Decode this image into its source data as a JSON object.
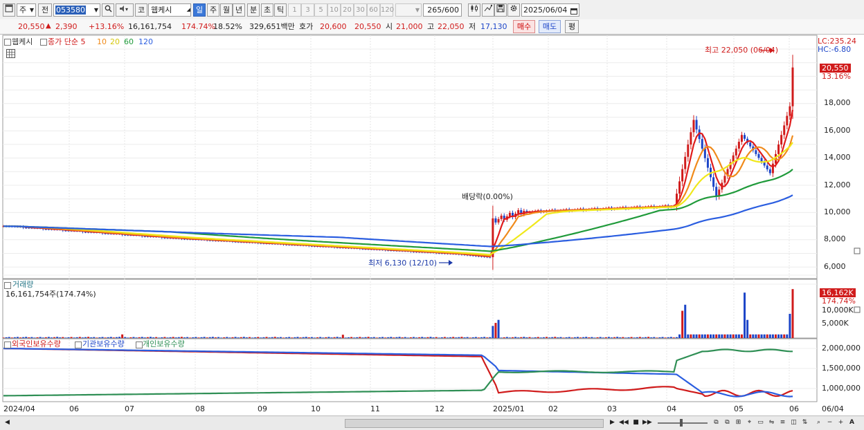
{
  "toolbar": {
    "market_select": "주",
    "prev_label": "전",
    "code_value": "053580",
    "market_kind": "코",
    "stock_name": "웹케시",
    "period_buttons": [
      "일",
      "주",
      "월",
      "년",
      "분",
      "초",
      "틱"
    ],
    "interval_buttons": [
      "1",
      "3",
      "5",
      "10",
      "20",
      "30",
      "60",
      "120"
    ],
    "count_value": "265",
    "count_total": "/600",
    "date_value": "2025/06/04"
  },
  "quote": {
    "price": "20,550",
    "change": "2,390",
    "change_pct": "+13.16%",
    "volume": "16,161,754",
    "vol_ratio": "174.74%",
    "turnover": "18.52%",
    "amount": "329,651백만",
    "bid_label": "호가",
    "bid": "20,600",
    "ask": "20,550",
    "open_label": "시",
    "open": "21,000",
    "high_label": "고",
    "high": "22,050",
    "low_label": "저",
    "low": "17,130",
    "buy_button": "매수",
    "sell_button": "매도",
    "eval_button": "평"
  },
  "price_panel": {
    "legend_name": "웹케시",
    "ma_label": "종가 단순 5",
    "ma_periods": [
      "10",
      "20",
      "60",
      "120"
    ],
    "lc_label": "LC:235.24",
    "hc_label": "HC:-6.80",
    "last_price_tag": "20,550",
    "last_pct_tag": "13.16%",
    "y_ticks": [
      "18,000",
      "16,000",
      "14,000",
      "12,000",
      "10,000",
      "8,000",
      "6,000"
    ],
    "high_annotation": "최고 22,050 (06/04)",
    "low_annotation": "최저 6,130 (12/10)",
    "dividend_annotation": "배당락(0.00%)"
  },
  "volume_panel": {
    "title": "거래량",
    "value_label": "16,161,754주(174.74%)",
    "tag_value": "16,162K",
    "tag_pct": "174.74%",
    "y_ticks": [
      "10,000K",
      "5,000K"
    ]
  },
  "holding_panel": {
    "legend": [
      "외국인보유수량",
      "기관보유수량",
      "개인보유수량"
    ],
    "y_ticks": [
      "2,000,000",
      "1,500,000",
      "1,000,000"
    ]
  },
  "x_axis": {
    "labels": [
      "2024/04",
      "06",
      "07",
      "08",
      "09",
      "10",
      "11",
      "12",
      "2025/01",
      "02",
      "03",
      "04",
      "05",
      "06"
    ],
    "right_label": "06/04"
  },
  "colors": {
    "rise": "#d01b1b",
    "fall": "#1c45c8",
    "ma5": "#e01b1b",
    "ma10": "#f08a1a",
    "ma20": "#f0e81a",
    "ma60": "#1f9a3a",
    "ma120": "#2a5de0",
    "foreign": "#d01b1b",
    "institution": "#2a5de0",
    "individual": "#2f8f55"
  },
  "icons": [
    "window-icon",
    "search-icon",
    "speaker-icon",
    "candle-settings-icon",
    "draw-icon",
    "save-icon",
    "gear-icon",
    "calendar-icon",
    "grid-icon"
  ]
}
